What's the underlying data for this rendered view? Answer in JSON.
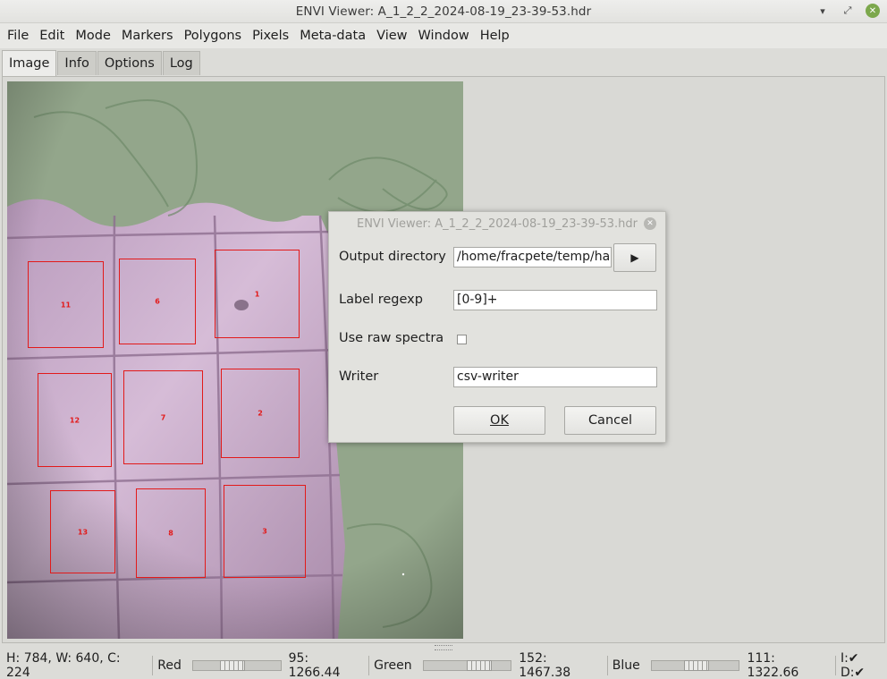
{
  "window": {
    "title": "ENVI Viewer: A_1_2_2_2024-08-19_23-39-53.hdr"
  },
  "menubar": {
    "items": [
      {
        "id": "file",
        "label": "File"
      },
      {
        "id": "edit",
        "label": "Edit"
      },
      {
        "id": "mode",
        "label": "Mode"
      },
      {
        "id": "markers",
        "label": "Markers"
      },
      {
        "id": "polygons",
        "label": "Polygons"
      },
      {
        "id": "pixels",
        "label": "Pixels"
      },
      {
        "id": "meta-data",
        "label": "Meta-data"
      },
      {
        "id": "view",
        "label": "View"
      },
      {
        "id": "window",
        "label": "Window"
      },
      {
        "id": "help",
        "label": "Help"
      }
    ]
  },
  "tabs": {
    "items": [
      {
        "id": "image",
        "label": "Image",
        "active": true
      },
      {
        "id": "info",
        "label": "Info",
        "active": false
      },
      {
        "id": "options",
        "label": "Options",
        "active": false
      },
      {
        "id": "log",
        "label": "Log",
        "active": false
      }
    ]
  },
  "image": {
    "regions": [
      {
        "label": "11"
      },
      {
        "label": "6"
      },
      {
        "label": "1"
      },
      {
        "label": "12"
      },
      {
        "label": "7"
      },
      {
        "label": "2"
      },
      {
        "label": "13"
      },
      {
        "label": "8"
      },
      {
        "label": "3"
      }
    ],
    "region_color": "#e21a1a"
  },
  "dialog": {
    "title": "ENVI Viewer: A_1_2_2_2024-08-19_23-39-53.hdr",
    "output_directory": {
      "label": "Output directory",
      "value": "/home/fracpete/temp/happ"
    },
    "browse_button": {
      "label": "▶"
    },
    "label_regexp": {
      "label": "Label regexp",
      "value": "[0-9]+"
    },
    "use_raw_spectra": {
      "label": "Use raw spectra",
      "checked": false
    },
    "writer": {
      "label": "Writer",
      "value": "csv-writer"
    },
    "ok_button": {
      "label": "OK"
    },
    "cancel_button": {
      "label": "Cancel"
    }
  },
  "statusbar": {
    "dimensions": "H: 784, W: 640, C: 224",
    "red": {
      "label": "Red",
      "value": "95: 1266.44"
    },
    "green": {
      "label": "Green",
      "value": "152: 1467.38"
    },
    "blue": {
      "label": "Blue",
      "value": "111: 1322.66"
    },
    "flags": "I:✔ D:✔"
  }
}
